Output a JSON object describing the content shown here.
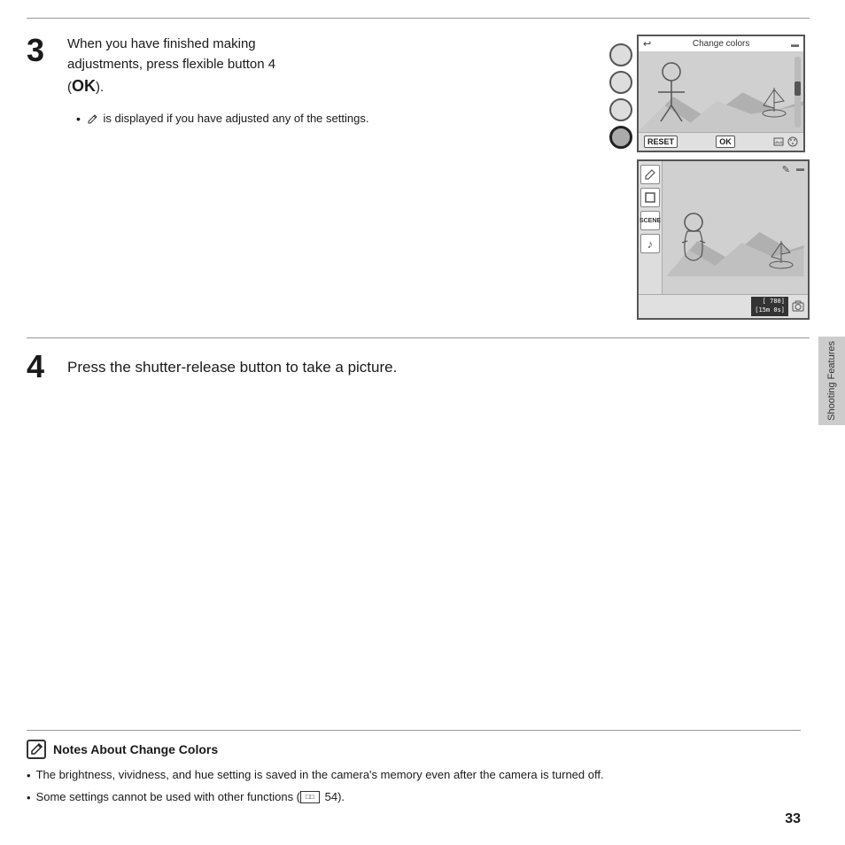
{
  "page": {
    "number": "33",
    "side_tab_label": "Shooting Features"
  },
  "step3": {
    "number": "3",
    "text_line1": "When you have finished making",
    "text_line2": "adjustments, press flexible button 4",
    "text_line3_before": "(",
    "text_ok": "OK",
    "text_line3_after": ").",
    "bullet": "is displayed if you have adjusted any of the settings."
  },
  "step4": {
    "number": "4",
    "text": "Press the shutter-release button to take a picture."
  },
  "screen_top": {
    "back_arrow": "↩",
    "title": "Change colors",
    "mini_icon": "▬",
    "reset_label": "RESET",
    "ok_label": "OK"
  },
  "screen_bottom": {
    "pencil_icon": "✎",
    "counter": "[ 780]\n[15m 0s]",
    "camera_icon": "⬛"
  },
  "notes": {
    "title": "Notes About Change Colors",
    "icon_char": "✎",
    "bullets": [
      "The brightness, vividness, and hue setting is saved in the camera's memory even after the camera is turned off.",
      "Some settings cannot be used with other functions (  54)."
    ],
    "book_ref": "□□"
  }
}
